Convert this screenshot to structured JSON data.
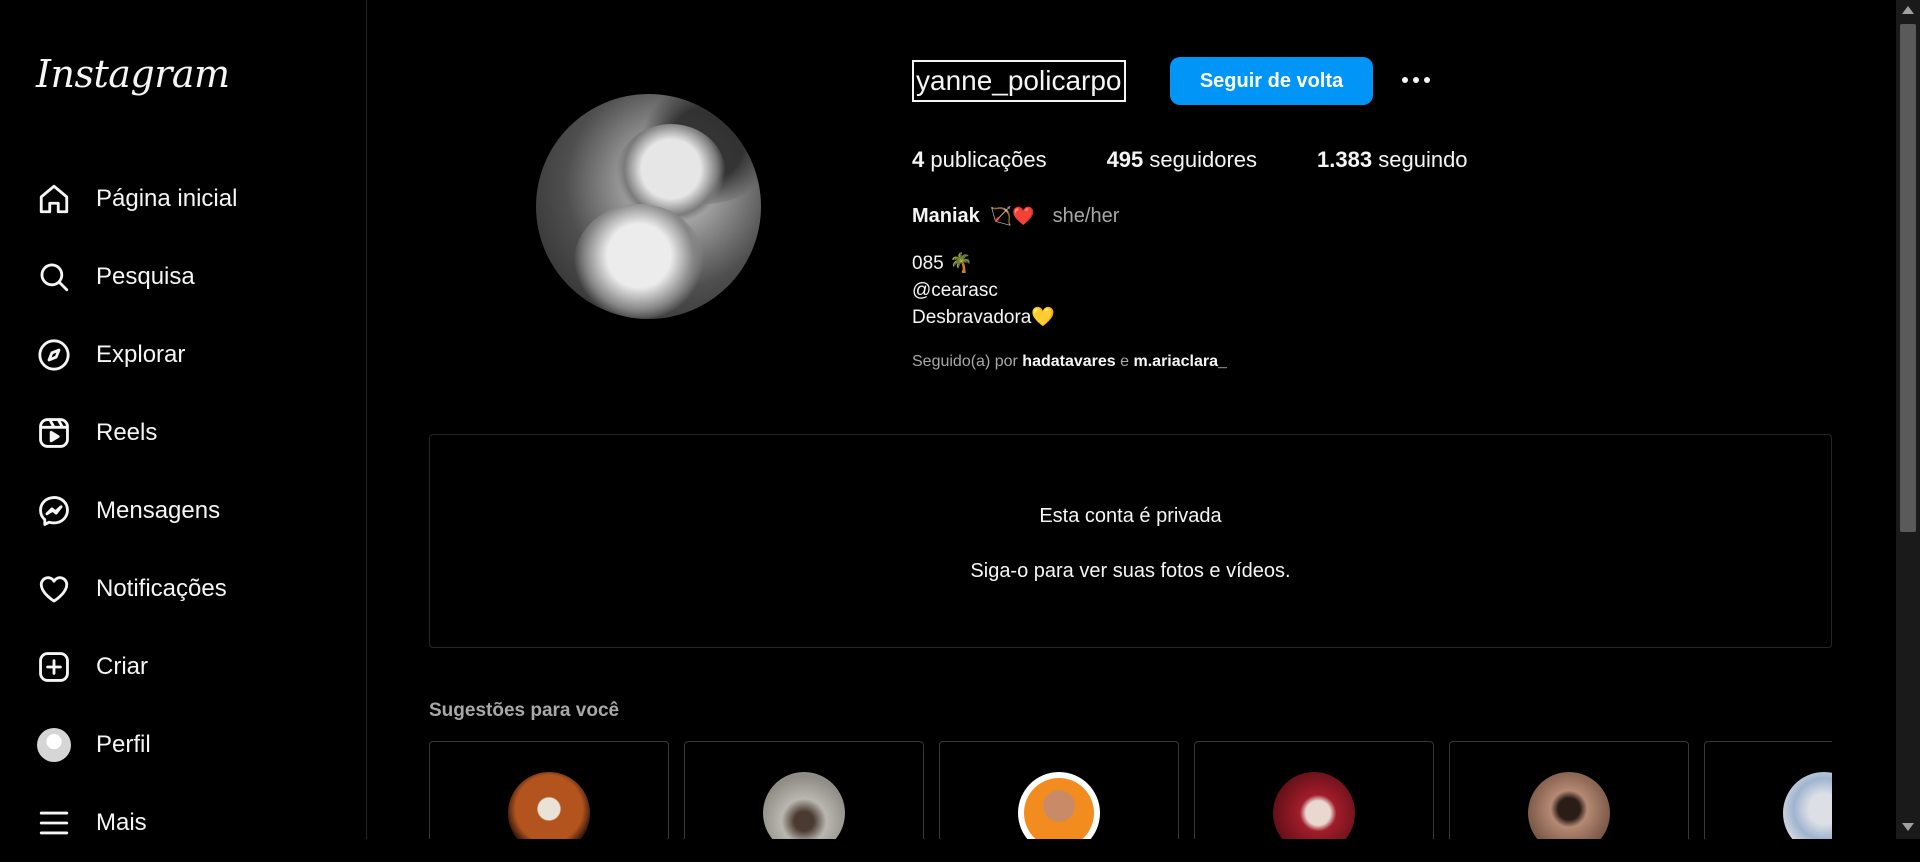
{
  "app": {
    "logo_text": "Instagram"
  },
  "sidebar": {
    "items": [
      {
        "label": "Página inicial",
        "icon": "home-icon"
      },
      {
        "label": "Pesquisa",
        "icon": "search-icon"
      },
      {
        "label": "Explorar",
        "icon": "compass-icon"
      },
      {
        "label": "Reels",
        "icon": "reels-icon"
      },
      {
        "label": "Mensagens",
        "icon": "messenger-icon"
      },
      {
        "label": "Notificações",
        "icon": "heart-icon"
      },
      {
        "label": "Criar",
        "icon": "plus-square-icon"
      },
      {
        "label": "Perfil",
        "icon": "profile-avatar"
      },
      {
        "label": "Mais",
        "icon": "menu-icon"
      }
    ]
  },
  "profile": {
    "username": "yanne_policarpo",
    "follow_button": "Seguir de volta",
    "more_icon": "more-options-icon",
    "stats": {
      "posts_count": "4",
      "posts_label": "publicações",
      "followers_count": "495",
      "followers_label": "seguidores",
      "following_count": "1.383",
      "following_label": "seguindo"
    },
    "name": "Maniak",
    "name_emojis": "🏹❤️",
    "pronouns": "she/her",
    "bio_lines": [
      "085 🌴",
      "@cearasc",
      "Desbravadora💛"
    ],
    "followed_by_prefix": "Seguido(a) por",
    "followed_by_user1": "hadatavares",
    "followed_by_and": "e",
    "followed_by_user2": "m.ariaclara_"
  },
  "private_notice": {
    "title": "Esta conta é privada",
    "subtitle": "Siga-o para ver suas fotos e vídeos."
  },
  "suggestions": {
    "title": "Sugestões para você"
  },
  "colors": {
    "accent": "#0095f6",
    "background": "#000000",
    "border": "#262626",
    "muted_text": "#a8a8a8"
  }
}
